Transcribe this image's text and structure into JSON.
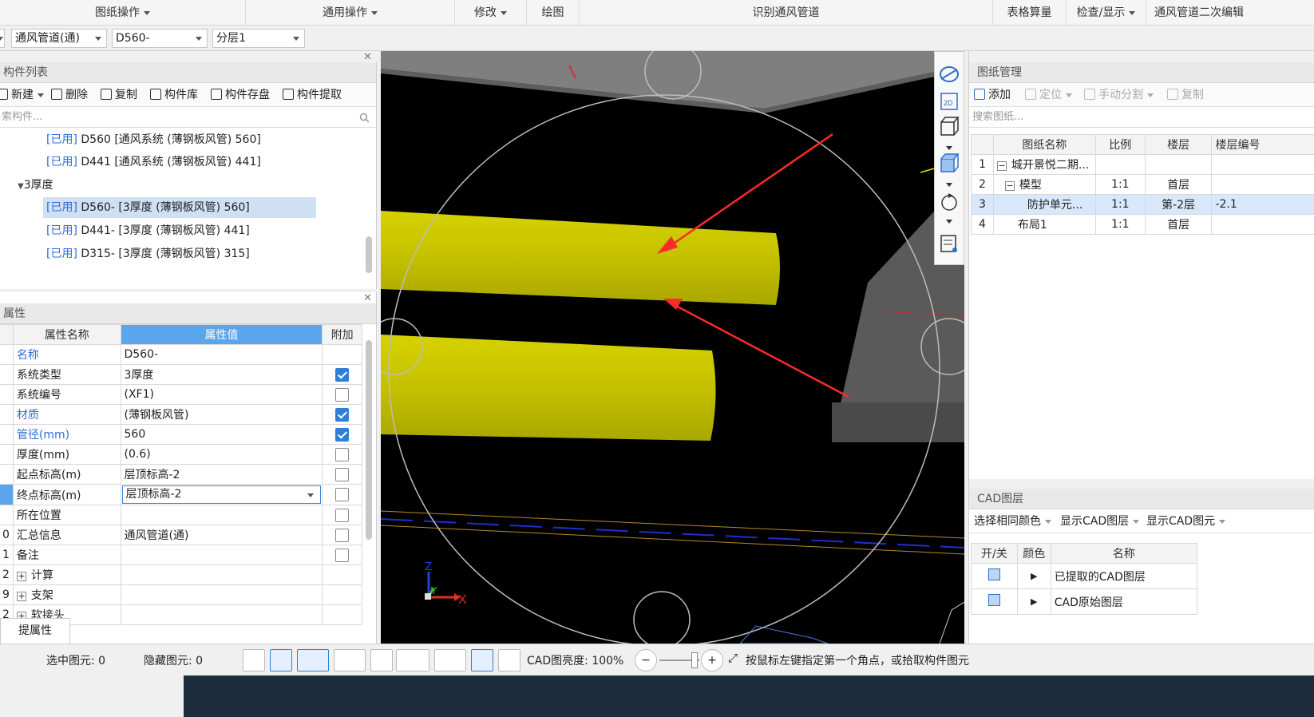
{
  "menu": {
    "drawing_ops": "图纸操作",
    "general_ops": "通用操作",
    "modify": "修改",
    "draw": "绘图",
    "identify": "识别通风管道",
    "table_calc": "表格算量",
    "check_display": "检查/显示",
    "secondary_edit": "通风管道二次编辑"
  },
  "combos": {
    "type": "通风管道(通)",
    "component": "D560-",
    "layer": "分层1"
  },
  "component_list": {
    "title": "构件列表",
    "toolbar": {
      "new": "新建",
      "delete": "删除",
      "copy": "复制",
      "library": "构件库",
      "save": "构件存盘",
      "extract": "构件提取"
    },
    "search_placeholder": "索构件...",
    "items": [
      {
        "tag": "[已用]",
        "text": "D560 [通风系统 (薄钢板风管) 560]"
      },
      {
        "tag": "[已用]",
        "text": "D441 [通风系统 (薄钢板风管) 441]"
      },
      {
        "group": "3厚度"
      },
      {
        "tag": "[已用]",
        "text": "D560- [3厚度 (薄钢板风管) 560]"
      },
      {
        "tag": "[已用]",
        "text": "D441- [3厚度 (薄钢板风管) 441]"
      },
      {
        "tag": "[已用]",
        "text": "D315- [3厚度 (薄钢板风管) 315]"
      }
    ]
  },
  "properties": {
    "title": "属性",
    "headers": {
      "name": "属性名称",
      "value": "属性值",
      "extra": "附加"
    },
    "rows": [
      {
        "idx": "",
        "name": "名称",
        "value": "D560-",
        "checked": null,
        "blue": true
      },
      {
        "idx": "",
        "name": "系统类型",
        "value": "3厚度",
        "checked": true,
        "blue": false
      },
      {
        "idx": "",
        "name": "系统编号",
        "value": "(XF1)",
        "checked": false,
        "blue": false
      },
      {
        "idx": "",
        "name": "材质",
        "value": "(薄钢板风管)",
        "checked": true,
        "blue": true
      },
      {
        "idx": "",
        "name": "管径(mm)",
        "value": "560",
        "checked": true,
        "blue": true
      },
      {
        "idx": "",
        "name": "厚度(mm)",
        "value": "(0.6)",
        "checked": false,
        "blue": false
      },
      {
        "idx": "",
        "name": "起点标高(m)",
        "value": "层顶标高-2",
        "checked": false,
        "blue": false
      },
      {
        "idx": "",
        "name": "终点标高(m)",
        "value": "层顶标高-2",
        "checked": false,
        "blue": false
      },
      {
        "idx": "",
        "name": "所在位置",
        "value": "",
        "checked": false,
        "blue": false
      },
      {
        "idx": "0",
        "name": "汇总信息",
        "value": "通风管道(通)",
        "checked": false,
        "blue": false
      },
      {
        "idx": "1",
        "name": "备注",
        "value": "",
        "checked": false,
        "blue": false
      },
      {
        "idx": "2",
        "name": "计算",
        "value": "",
        "checked": null,
        "blue": false
      },
      {
        "idx": "9",
        "name": "支架",
        "value": "",
        "checked": null,
        "blue": false
      },
      {
        "idx": "2",
        "name": "软接头",
        "value": "",
        "checked": null,
        "blue": false
      }
    ],
    "extract_button": "提属性"
  },
  "drawing_mgmt": {
    "title": "图纸管理",
    "toolbar": {
      "add": "添加",
      "locate": "定位",
      "split": "手动分割",
      "copy": "复制"
    },
    "search_placeholder": "搜索图纸...",
    "headers": {
      "name": "图纸名称",
      "scale": "比例",
      "floor": "楼层",
      "floor_no": "楼层编号"
    },
    "rows": [
      {
        "idx": "1",
        "name": "城开景悦二期...",
        "scale": "",
        "floor": "",
        "floor_no": ""
      },
      {
        "idx": "2",
        "name": "模型",
        "scale": "1:1",
        "floor": "首层",
        "floor_no": ""
      },
      {
        "idx": "3",
        "name": "防护单元...",
        "scale": "1:1",
        "floor": "第-2层",
        "floor_no": "-2.1"
      },
      {
        "idx": "4",
        "name": "布局1",
        "scale": "1:1",
        "floor": "首层",
        "floor_no": ""
      }
    ]
  },
  "cad_layers": {
    "title": "CAD图层",
    "toolbar": {
      "same_color": "选择相同颜色",
      "show_layer": "显示CAD图层",
      "show_element": "显示CAD图元"
    },
    "headers": {
      "toggle": "开/关",
      "color": "颜色",
      "name": "名称"
    },
    "rows": [
      {
        "name": "已提取的CAD图层"
      },
      {
        "name": "CAD原始图层"
      }
    ]
  },
  "status": {
    "selected": "选中图元: 0",
    "hidden": "隐藏图元: 0",
    "brightness": "CAD图亮度: 100%",
    "hint": "按鼠标左键指定第一个角点，或拾取构件图元"
  },
  "axis": {
    "x": "X",
    "y": "Y",
    "z": "Z"
  },
  "colors": {
    "pipe": "#c8c400",
    "accent": "#2f7fd8",
    "arrow": "#ff2a2a"
  }
}
